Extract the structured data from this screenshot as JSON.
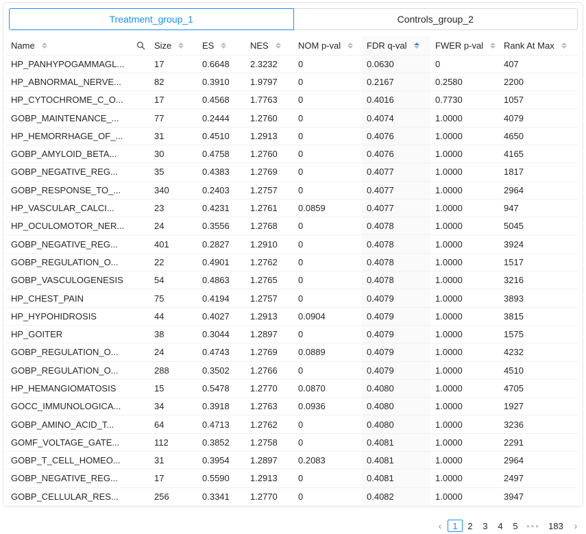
{
  "tabs": [
    {
      "label": "Treatment_group_1",
      "active": true
    },
    {
      "label": "Controls_group_2",
      "active": false
    }
  ],
  "columns": [
    "Name",
    "Size",
    "ES",
    "NES",
    "NOM p-val",
    "FDR q-val",
    "FWER p-val",
    "Rank At Max"
  ],
  "sorted_column": "FDR q-val",
  "sort_direction": "ascending",
  "rows": [
    [
      "HP_PANHYPOGAMMAGL...",
      "17",
      "0.6648",
      "2.3232",
      "0",
      "0.0630",
      "0",
      "407"
    ],
    [
      "HP_ABNORMAL_NERVE...",
      "82",
      "0.3910",
      "1.9797",
      "0",
      "0.2167",
      "0.2580",
      "2200"
    ],
    [
      "HP_CYTOCHROME_C_O...",
      "17",
      "0.4568",
      "1.7763",
      "0",
      "0.4016",
      "0.7730",
      "1057"
    ],
    [
      "GOBP_MAINTENANCE_...",
      "77",
      "0.2444",
      "1.2760",
      "0",
      "0.4074",
      "1.0000",
      "4079"
    ],
    [
      "HP_HEMORRHAGE_OF_...",
      "31",
      "0.4510",
      "1.2913",
      "0",
      "0.4076",
      "1.0000",
      "4650"
    ],
    [
      "GOBP_AMYLOID_BETA...",
      "30",
      "0.4758",
      "1.2760",
      "0",
      "0.4076",
      "1.0000",
      "4165"
    ],
    [
      "GOBP_NEGATIVE_REG...",
      "35",
      "0.4383",
      "1.2769",
      "0",
      "0.4077",
      "1.0000",
      "1817"
    ],
    [
      "GOBP_RESPONSE_TO_...",
      "340",
      "0.2403",
      "1.2757",
      "0",
      "0.4077",
      "1.0000",
      "2964"
    ],
    [
      "HP_VASCULAR_CALCI...",
      "23",
      "0.4231",
      "1.2761",
      "0.0859",
      "0.4077",
      "1.0000",
      "947"
    ],
    [
      "HP_OCULOMOTOR_NER...",
      "24",
      "0.3556",
      "1.2768",
      "0",
      "0.4078",
      "1.0000",
      "5045"
    ],
    [
      "GOBP_NEGATIVE_REG...",
      "401",
      "0.2827",
      "1.2910",
      "0",
      "0.4078",
      "1.0000",
      "3924"
    ],
    [
      "GOBP_REGULATION_O...",
      "22",
      "0.4901",
      "1.2762",
      "0",
      "0.4078",
      "1.0000",
      "1517"
    ],
    [
      "GOBP_VASCULOGENESIS",
      "54",
      "0.4863",
      "1.2765",
      "0",
      "0.4078",
      "1.0000",
      "3216"
    ],
    [
      "HP_CHEST_PAIN",
      "75",
      "0.4194",
      "1.2757",
      "0",
      "0.4079",
      "1.0000",
      "3893"
    ],
    [
      "HP_HYPOHIDROSIS",
      "44",
      "0.4027",
      "1.2913",
      "0.0904",
      "0.4079",
      "1.0000",
      "3815"
    ],
    [
      "HP_GOITER",
      "38",
      "0.3044",
      "1.2897",
      "0",
      "0.4079",
      "1.0000",
      "1575"
    ],
    [
      "GOBP_REGULATION_O...",
      "24",
      "0.4743",
      "1.2769",
      "0.0889",
      "0.4079",
      "1.0000",
      "4232"
    ],
    [
      "GOBP_REGULATION_O...",
      "288",
      "0.3502",
      "1.2766",
      "0",
      "0.4079",
      "1.0000",
      "4510"
    ],
    [
      "HP_HEMANGIOMATOSIS",
      "15",
      "0.5478",
      "1.2770",
      "0.0870",
      "0.4080",
      "1.0000",
      "4705"
    ],
    [
      "GOCC_IMMUNOLOGICA...",
      "34",
      "0.3918",
      "1.2763",
      "0.0936",
      "0.4080",
      "1.0000",
      "1927"
    ],
    [
      "GOBP_AMINO_ACID_T...",
      "64",
      "0.4713",
      "1.2762",
      "0",
      "0.4080",
      "1.0000",
      "3236"
    ],
    [
      "GOMF_VOLTAGE_GATE...",
      "112",
      "0.3852",
      "1.2758",
      "0",
      "0.4081",
      "1.0000",
      "2291"
    ],
    [
      "GOBP_T_CELL_HOMEO...",
      "31",
      "0.3954",
      "1.2897",
      "0.2083",
      "0.4081",
      "1.0000",
      "2964"
    ],
    [
      "GOBP_NEGATIVE_REG...",
      "17",
      "0.5590",
      "1.2913",
      "0",
      "0.4081",
      "1.0000",
      "2497"
    ],
    [
      "GOBP_CELLULAR_RES...",
      "256",
      "0.3341",
      "1.2770",
      "0",
      "0.4082",
      "1.0000",
      "3947"
    ]
  ],
  "pagination": {
    "prev_icon": "chevron-left-icon",
    "next_icon": "chevron-right-icon",
    "pages": [
      "1",
      "2",
      "3",
      "4",
      "5"
    ],
    "ellipsis": "•••",
    "last_page": "183",
    "current_page": "1"
  },
  "colors": {
    "accent": "#1890ff",
    "border": "#d9d9d9",
    "row_divider": "#f0f0f0",
    "sorted_column_bg": "#fafafa"
  }
}
